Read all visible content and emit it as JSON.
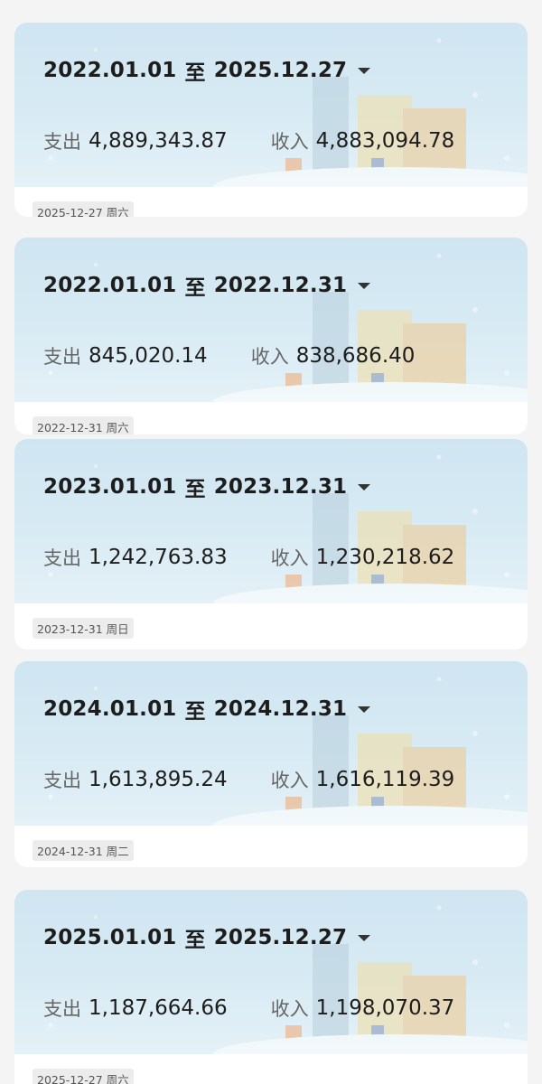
{
  "cards": [
    {
      "start_date": "2022.01.01",
      "separator": "至",
      "end_date": "2025.12.27",
      "expense_label": "支出",
      "expense_value": "4,889,343.87",
      "income_label": "收入",
      "income_value": "4,883,094.78",
      "date_tag": "2025-12-27 周六"
    },
    {
      "start_date": "2022.01.01",
      "separator": "至",
      "end_date": "2022.12.31",
      "expense_label": "支出",
      "expense_value": "845,020.14",
      "income_label": "收入",
      "income_value": "838,686.40",
      "date_tag": "2022-12-31 周六"
    },
    {
      "start_date": "2023.01.01",
      "separator": "至",
      "end_date": "2023.12.31",
      "expense_label": "支出",
      "expense_value": "1,242,763.83",
      "income_label": "收入",
      "income_value": "1,230,218.62",
      "date_tag": "2023-12-31 周日"
    },
    {
      "start_date": "2024.01.01",
      "separator": "至",
      "end_date": "2024.12.31",
      "expense_label": "支出",
      "expense_value": "1,613,895.24",
      "income_label": "收入",
      "income_value": "1,616,119.39",
      "date_tag": "2024-12-31 周二"
    },
    {
      "start_date": "2025.01.01",
      "separator": "至",
      "end_date": "2025.12.27",
      "expense_label": "支出",
      "expense_value": "1,187,664.66",
      "income_label": "收入",
      "income_value": "1,198,070.37",
      "date_tag": "2025-12-27 周六"
    }
  ],
  "icons": {
    "dropdown": "caret-down-icon",
    "banner_art": "winter-town-illustration"
  },
  "colors": {
    "banner_top": "#cfe5f1",
    "banner_bottom": "#e4f1f7",
    "text_primary": "#1d1d1d",
    "text_secondary": "#666666",
    "tag_bg": "#ececec",
    "page_bg": "#f4f4f5"
  }
}
